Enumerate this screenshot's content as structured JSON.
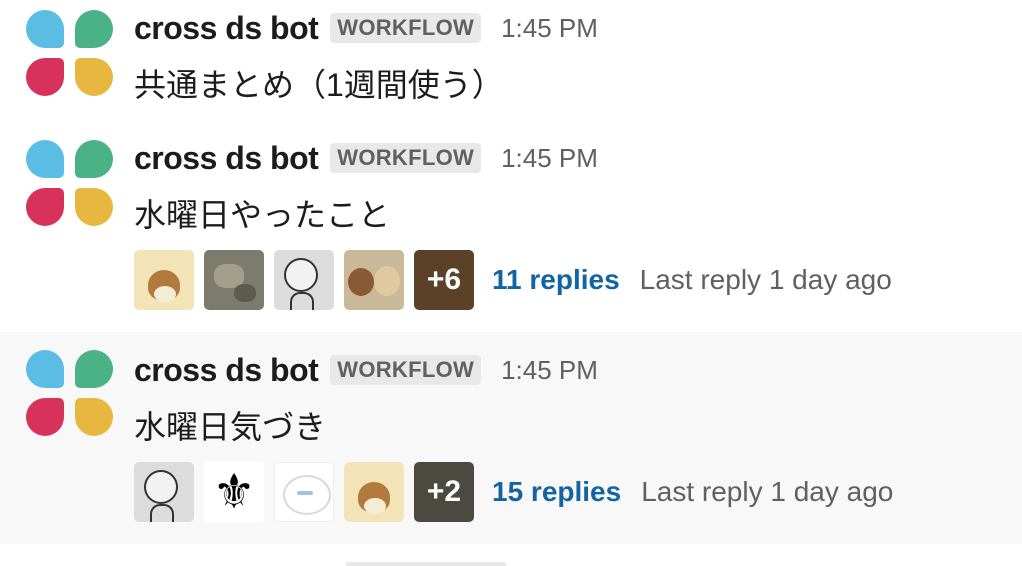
{
  "messages": [
    {
      "username": "cross ds bot",
      "badge": "WORKFLOW",
      "time": "1:45 PM",
      "text": "共通まとめ（1週間使う）"
    },
    {
      "username": "cross ds bot",
      "badge": "WORKFLOW",
      "time": "1:45 PM",
      "text": "水曜日やったこと",
      "thread": {
        "extra_count": "+6",
        "replies": "11 replies",
        "last_reply": "Last reply 1 day ago"
      }
    },
    {
      "username": "cross ds bot",
      "badge": "WORKFLOW",
      "time": "1:45 PM",
      "text": "水曜日気づき",
      "thread": {
        "extra_count": "+2",
        "replies": "15 replies",
        "last_reply": "Last reply 1 day ago"
      }
    }
  ],
  "icons": {
    "fleur": "⚜"
  },
  "colors": {
    "link": "#1264a3",
    "logo_blue": "#5bbde4",
    "logo_green": "#4ab286",
    "logo_red": "#d6325c",
    "logo_yellow": "#e8b73f"
  }
}
